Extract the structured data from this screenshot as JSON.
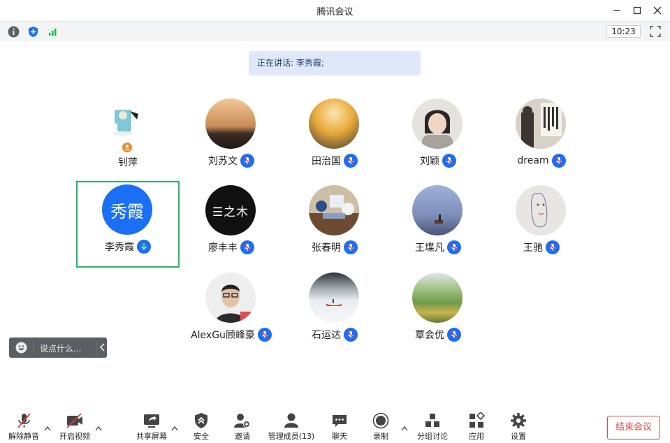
{
  "window": {
    "title": "腾讯会议"
  },
  "status": {
    "time": "10:23"
  },
  "speaking": {
    "label": "正在讲话: 李秀霞;"
  },
  "participants": [
    {
      "name": "钊萍",
      "muted_icon": "camera-off-badge",
      "color": "#7ec9d6"
    },
    {
      "name": "刘苏文",
      "muted_icon": "mic-icon",
      "color": "#c98d5a"
    },
    {
      "name": "田治国",
      "muted_icon": "mic-icon",
      "color": "#d9a23a"
    },
    {
      "name": "刘颖",
      "muted_icon": "mic-icon",
      "color": "#b7b2ab"
    },
    {
      "name": "dream",
      "muted_icon": "mic-icon",
      "color": "#8c8077"
    },
    {
      "name": "李秀霞",
      "avatar_text": "秀霞",
      "muted_icon": "mic-active-icon",
      "color": "#1a6ff5"
    },
    {
      "name": "廖丰丰",
      "avatar_text": "☰之木",
      "muted_icon": "mic-icon",
      "color": "#111111"
    },
    {
      "name": "张春明",
      "muted_icon": "mic-icon",
      "color": "#b9a88f"
    },
    {
      "name": "王堞凡",
      "muted_icon": "mic-icon",
      "color": "#7d8fb8"
    },
    {
      "name": "王驰",
      "muted_icon": "mic-icon",
      "color": "#e8e6e3"
    },
    {
      "name": "AlexGu顾峰豪",
      "muted_icon": "mic-icon",
      "color": "#4a4a4a"
    },
    {
      "name": "石运达",
      "muted_icon": "mic-icon",
      "color": "#cfd6dc"
    },
    {
      "name": "覃会优",
      "muted_icon": "mic-icon",
      "color": "#6f9a4c"
    }
  ],
  "chat": {
    "placeholder": "说点什么..."
  },
  "toolbar": {
    "unmute": "解除静音",
    "start_video": "开启视频",
    "share_screen": "共享屏幕",
    "security": "安全",
    "invite": "邀请",
    "manage_members": "管理成员(13)",
    "chat": "聊天",
    "record": "录制",
    "breakout": "分组讨论",
    "apps": "应用",
    "settings": "设置",
    "end_meeting": "结束会议"
  },
  "colors": {
    "accent": "#1a6ff5",
    "active_border": "#2ab26a",
    "end": "#e64545",
    "banner": "#dfe9fa"
  }
}
